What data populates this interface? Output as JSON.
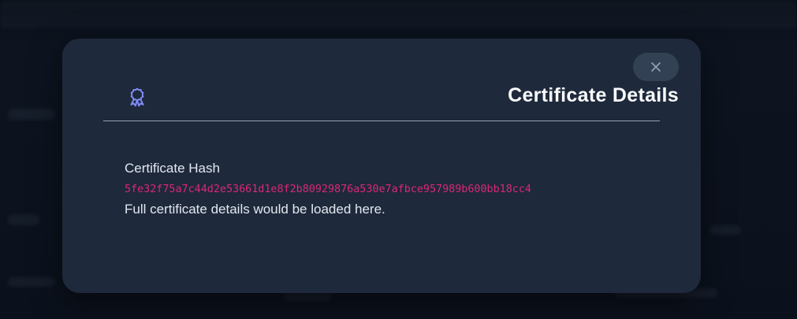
{
  "modal": {
    "title": "Certificate Details",
    "hash_label": "Certificate Hash",
    "hash_value": "5fe32f75a7c44d2e53661d1e8f2b80929876a530e7afbce957989b600bb18cc4",
    "note": "Full certificate details would be loaded here.",
    "close_icon": "close-icon",
    "header_icon": "award-badge-icon"
  },
  "colors": {
    "backdrop": "#0b111c",
    "modal_bg": "#1e293b",
    "accent_icon": "#818cf8",
    "hash_text": "#db2777",
    "title_text": "#f8fafc"
  }
}
